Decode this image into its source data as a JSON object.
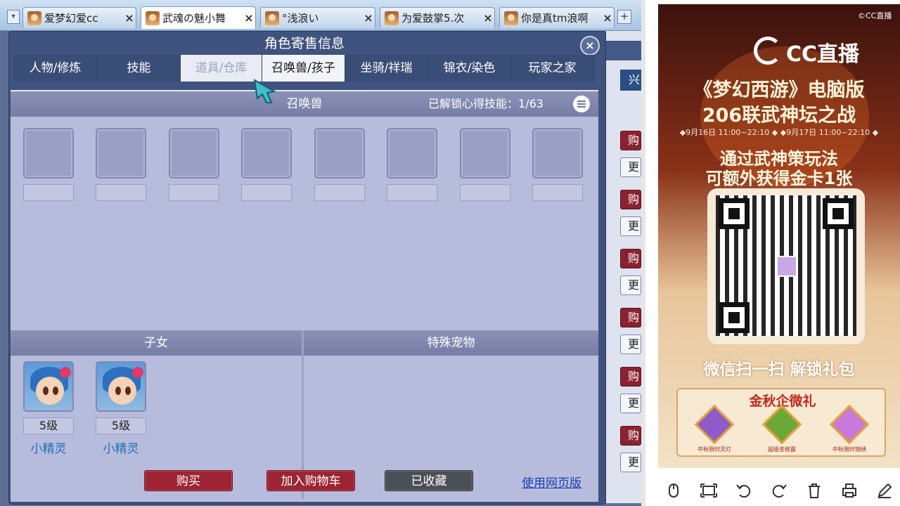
{
  "browser": {
    "tabs": [
      {
        "label": "爱梦幻爱cc",
        "active": false
      },
      {
        "label": "武魂の魅小舞",
        "active": true
      },
      {
        "label": "°浅浪い",
        "active": false
      },
      {
        "label": "为爱鼓掌5.次",
        "active": false
      },
      {
        "label": "你是真tm浪啊",
        "active": false
      }
    ],
    "close_glyph": "×",
    "dropdown_glyph": "▾",
    "new_tab_glyph": "+"
  },
  "panel": {
    "title": "角色寄售信息",
    "close_glyph": "×",
    "tabs": [
      {
        "label": "人物/修炼"
      },
      {
        "label": "技能"
      },
      {
        "label": "道具/仓库",
        "state": "active"
      },
      {
        "label": "召唤兽/孩子",
        "state": "hover"
      },
      {
        "label": "坐骑/祥瑞"
      },
      {
        "label": "锦衣/染色"
      },
      {
        "label": "玩家之家"
      }
    ],
    "summons_section": {
      "title": "召唤兽",
      "unlock_label": "已解锁心得技能：",
      "unlock_value": "1/63",
      "empty_slots": 8
    },
    "children_section": {
      "title": "子女",
      "items": [
        {
          "level": "5级",
          "name": "小精灵"
        },
        {
          "level": "5级",
          "name": "小精灵"
        }
      ]
    },
    "special_pets_section": {
      "title": "特殊宠物"
    },
    "buttons": {
      "buy": "购买",
      "add_cart": "加入购物车",
      "favorited": "已收藏",
      "web_version": "使用网页版"
    },
    "colors": {
      "accent_red": "#9c2433",
      "link_blue": "#1a3fb6"
    }
  },
  "behind_panel": {
    "blue_btn": "兴",
    "buttons": [
      "购",
      "更",
      "购",
      "更",
      "购",
      "更",
      "购",
      "更",
      "购",
      "更",
      "购",
      "更"
    ]
  },
  "sidebar": {
    "ad": {
      "watermark": "©CC直播",
      "logo": "CC直播",
      "title": "《梦幻西游》电脑版",
      "subtitle": "206联武神坛之战",
      "dates": "◆9月16日 11:00~22:10 ◆  ◆9月17日 11:00~22:10 ◆",
      "line1": "通过武神策玩法",
      "line2": "可额外获得金卡1张",
      "scan_text": "微信扫一扫 解锁礼包",
      "gift_title": "金秋企微礼",
      "gifts": [
        "中秋限时灵灯",
        "超级金柳露",
        "中秋限时锦绣"
      ]
    },
    "tools": [
      "pointer-icon",
      "fit-screen-icon",
      "undo-icon",
      "redo-icon",
      "trash-icon",
      "print-icon",
      "edit-icon"
    ]
  }
}
